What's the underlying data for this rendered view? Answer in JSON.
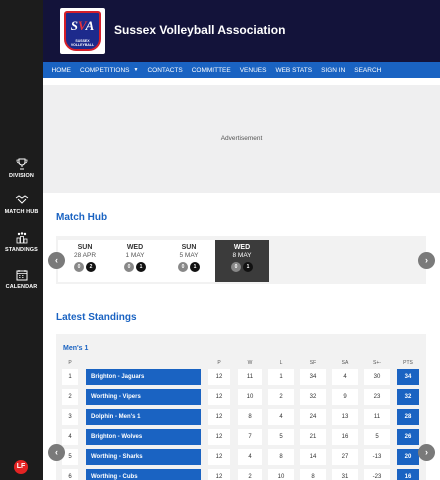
{
  "sidebar": {
    "items": [
      {
        "label": "DIVISION",
        "icon": "trophy-icon"
      },
      {
        "label": "MATCH HUB",
        "icon": "handshake-icon"
      },
      {
        "label": "STANDINGS",
        "icon": "podium-icon"
      },
      {
        "label": "CALENDAR",
        "icon": "calendar-icon"
      }
    ],
    "brand_badge": "LF"
  },
  "header": {
    "title": "Sussex Volleyball Association",
    "logo_letters": [
      "S",
      "V",
      "A"
    ],
    "logo_caption": "SUSSEX VOLLEYBALL"
  },
  "nav": {
    "items": [
      "HOME",
      "COMPETITIONS",
      "CONTACTS",
      "COMMITTEE",
      "VENUES",
      "WEB STATS",
      "SIGN IN",
      "SEARCH"
    ],
    "dropdown_caret": "▼"
  },
  "ad": {
    "label": "Advertisement"
  },
  "match_hub": {
    "title": "Match Hub",
    "prev_arrow": "‹",
    "next_arrow": "›",
    "days": [
      {
        "dow": "SUN",
        "date": "28 APR",
        "counts": [
          "0",
          "2"
        ],
        "active": false
      },
      {
        "dow": "WED",
        "date": "1 MAY",
        "counts": [
          "0",
          "1"
        ],
        "active": false
      },
      {
        "dow": "SUN",
        "date": "5 MAY",
        "counts": [
          "0",
          "1"
        ],
        "active": false
      },
      {
        "dow": "WED",
        "date": "8 MAY",
        "counts": [
          "0",
          "1"
        ],
        "active": true
      }
    ]
  },
  "standings": {
    "title": "Latest Standings",
    "league": "Men's 1",
    "prev_arrow": "‹",
    "next_arrow": "›",
    "columns": [
      "P",
      "P",
      "W",
      "L",
      "SF",
      "SA",
      "S+-",
      "PTS"
    ],
    "rows": [
      {
        "pos": "1",
        "team": "Brighton - Jaguars",
        "p": "12",
        "w": "11",
        "l": "1",
        "sf": "34",
        "sa": "4",
        "sd": "30",
        "pts": "34"
      },
      {
        "pos": "2",
        "team": "Worthing - Vipers",
        "p": "12",
        "w": "10",
        "l": "2",
        "sf": "32",
        "sa": "9",
        "sd": "23",
        "pts": "32"
      },
      {
        "pos": "3",
        "team": "Dolphin - Men's 1",
        "p": "12",
        "w": "8",
        "l": "4",
        "sf": "24",
        "sa": "13",
        "sd": "11",
        "pts": "28"
      },
      {
        "pos": "4",
        "team": "Brighton - Wolves",
        "p": "12",
        "w": "7",
        "l": "5",
        "sf": "21",
        "sa": "16",
        "sd": "5",
        "pts": "26"
      },
      {
        "pos": "5",
        "team": "Worthing - Sharks",
        "p": "12",
        "w": "4",
        "l": "8",
        "sf": "14",
        "sa": "27",
        "sd": "-13",
        "pts": "20"
      },
      {
        "pos": "6",
        "team": "Worthing - Cubs",
        "p": "12",
        "w": "2",
        "l": "10",
        "sf": "8",
        "sa": "31",
        "sd": "-23",
        "pts": "16"
      }
    ]
  },
  "colors": {
    "header_bg": "#13133a",
    "nav_bg": "#1a63c2",
    "accent": "#1a63c2",
    "sidebar_bg": "#1c1c1c"
  }
}
